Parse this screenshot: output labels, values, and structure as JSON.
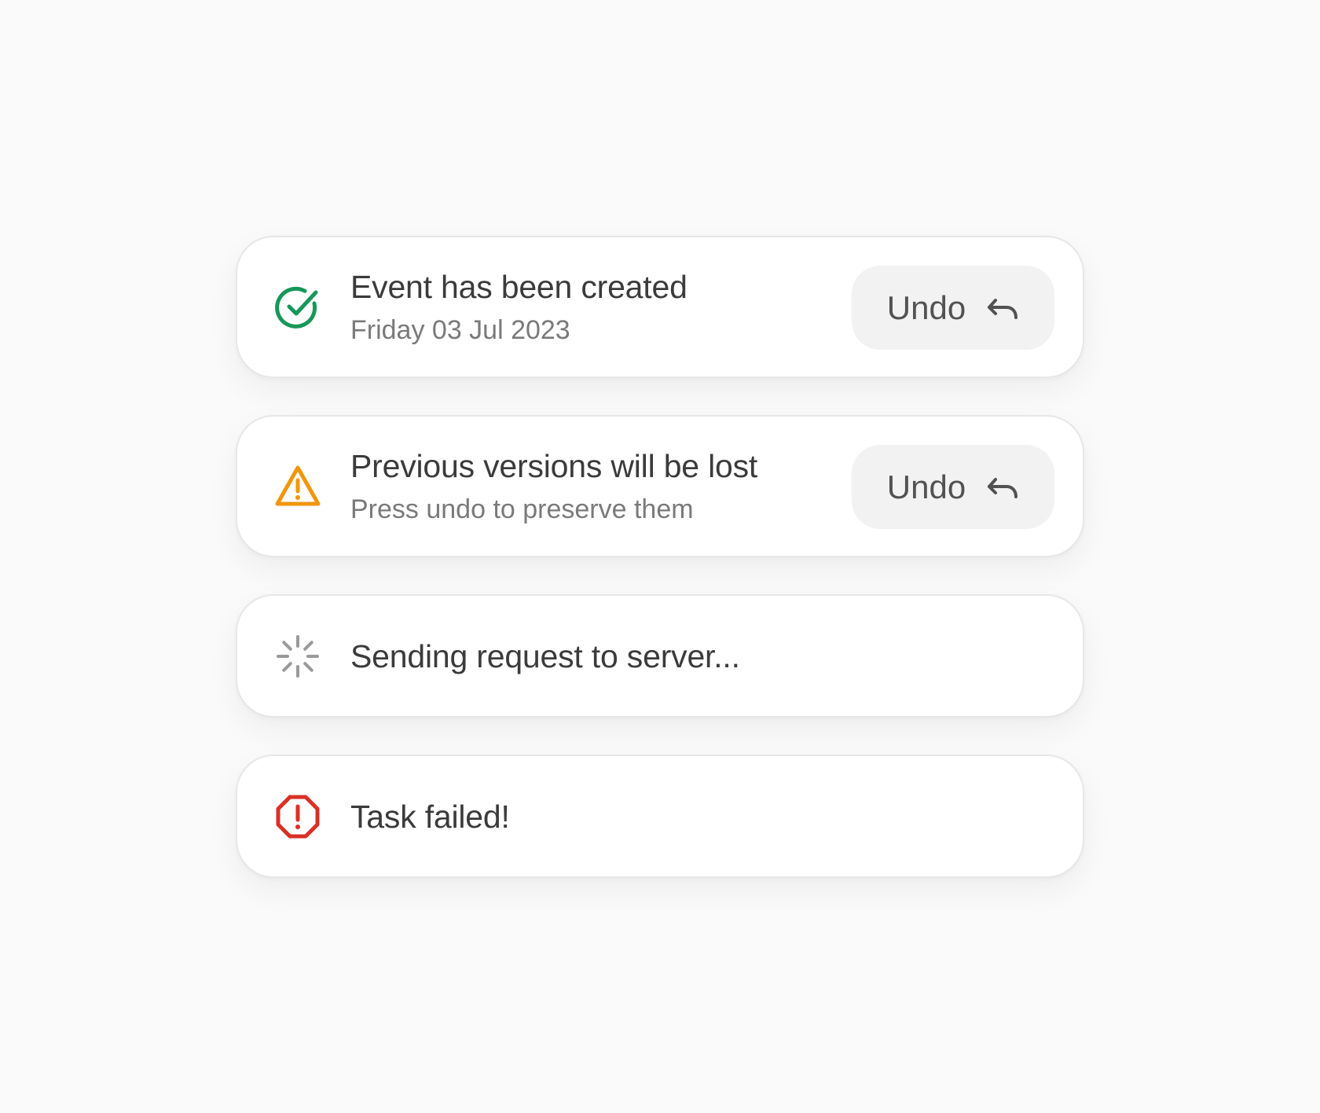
{
  "toasts": [
    {
      "variant": "success",
      "icon": "check-circle-icon",
      "color": "#17975a",
      "title": "Event has been created",
      "subtitle": "Friday 03 Jul 2023",
      "action_label": "Undo",
      "action_icon": "undo-arrow-icon"
    },
    {
      "variant": "warning",
      "icon": "warning-triangle-icon",
      "color": "#f0960e",
      "title": "Previous versions will be lost",
      "subtitle": "Press undo to preserve them",
      "action_label": "Undo",
      "action_icon": "undo-arrow-icon"
    },
    {
      "variant": "loading",
      "icon": "spinner-icon",
      "color": "#9a9a9a",
      "title": "Sending request to server..."
    },
    {
      "variant": "error",
      "icon": "error-octagon-icon",
      "color": "#d93025",
      "title": "Task failed!"
    }
  ]
}
